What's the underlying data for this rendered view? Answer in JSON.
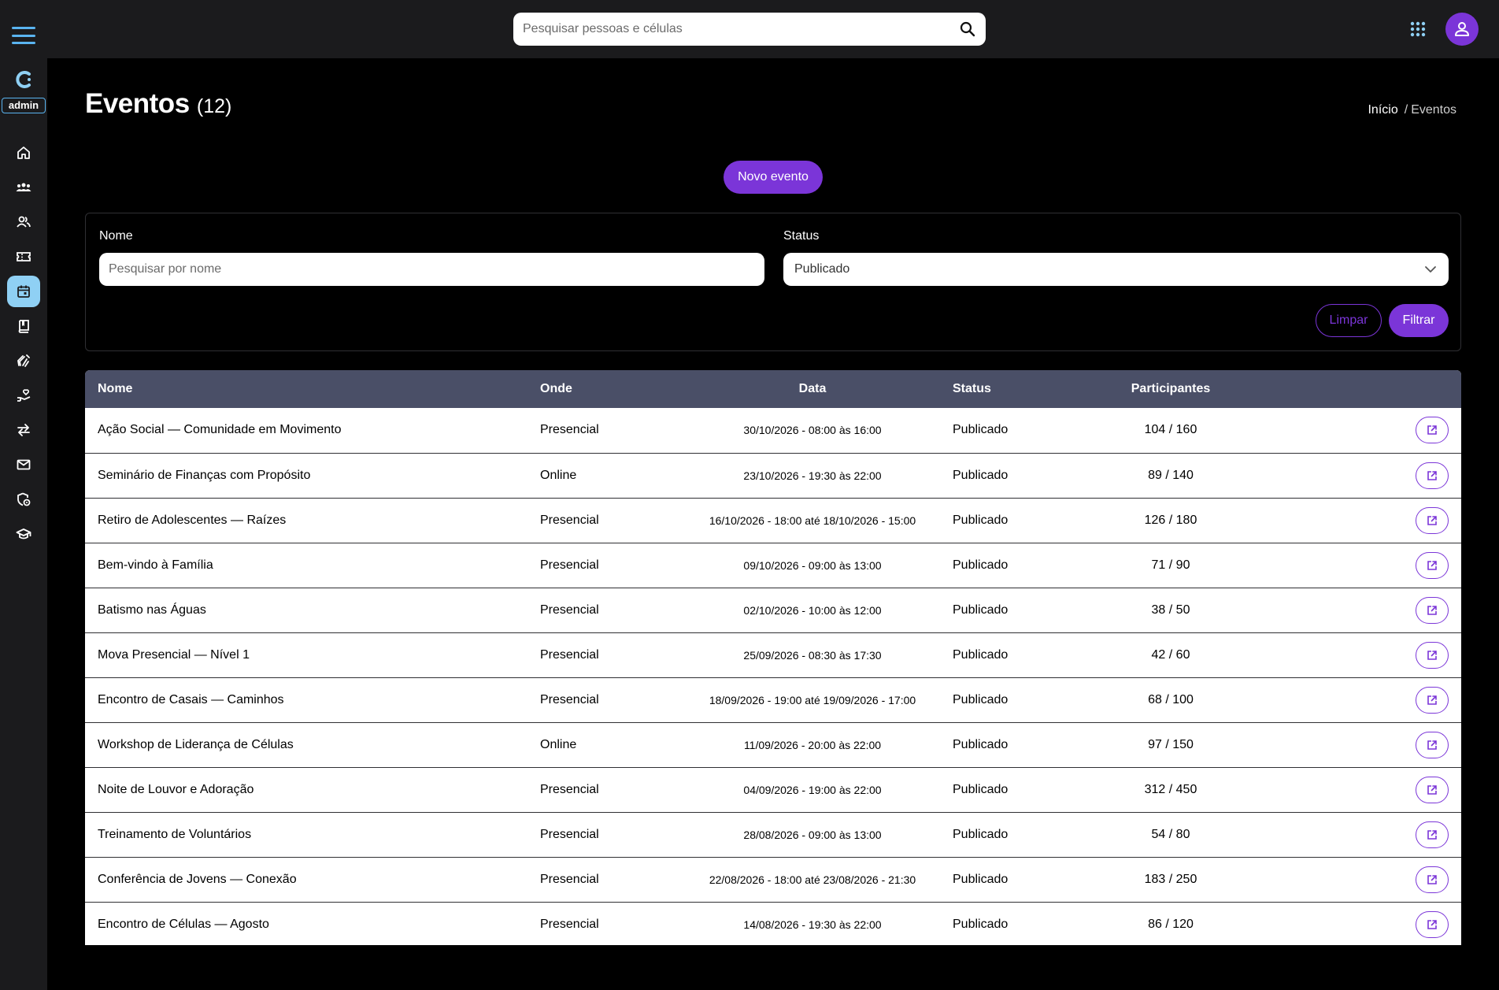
{
  "header": {
    "search_placeholder": "Pesquisar pessoas e células"
  },
  "sidebar": {
    "badge": "admin",
    "items": [
      {
        "icon": "home-icon"
      },
      {
        "icon": "group-icon"
      },
      {
        "icon": "people-icon"
      },
      {
        "icon": "ticket-icon"
      },
      {
        "icon": "calendar-icon",
        "active": true
      },
      {
        "icon": "book-icon"
      },
      {
        "icon": "hands-icon"
      },
      {
        "icon": "donation-icon"
      },
      {
        "icon": "transfer-icon"
      },
      {
        "icon": "mail-icon"
      },
      {
        "icon": "shield-settings-icon"
      },
      {
        "icon": "graduation-cap-icon"
      }
    ]
  },
  "page": {
    "title": "Eventos",
    "count": "(12)",
    "breadcrumb_home": "Início",
    "breadcrumb_sep": "/",
    "breadcrumb_current": "Eventos",
    "new_button": "Novo evento"
  },
  "filters": {
    "name_label": "Nome",
    "name_placeholder": "Pesquisar por nome",
    "status_label": "Status",
    "status_value": "Publicado",
    "clear_button": "Limpar",
    "filter_button": "Filtrar"
  },
  "table": {
    "columns": [
      "Nome",
      "Onde",
      "Data",
      "Status",
      "Participantes"
    ],
    "rows": [
      {
        "name": "Ação Social — Comunidade em Movimento",
        "where": "Presencial",
        "date": "30/10/2026 - 08:00 às 16:00",
        "status": "Publicado",
        "participants": "104 / 160"
      },
      {
        "name": "Seminário de Finanças com Propósito",
        "where": "Online",
        "date": "23/10/2026 - 19:30 às 22:00",
        "status": "Publicado",
        "participants": "89 / 140"
      },
      {
        "name": "Retiro de Adolescentes — Raízes",
        "where": "Presencial",
        "date": "16/10/2026 - 18:00 até 18/10/2026 - 15:00",
        "status": "Publicado",
        "participants": "126 / 180"
      },
      {
        "name": "Bem-vindo à Família",
        "where": "Presencial",
        "date": "09/10/2026 - 09:00 às 13:00",
        "status": "Publicado",
        "participants": "71 / 90"
      },
      {
        "name": "Batismo nas Águas",
        "where": "Presencial",
        "date": "02/10/2026 - 10:00 às 12:00",
        "status": "Publicado",
        "participants": "38 / 50"
      },
      {
        "name": "Mova Presencial — Nível 1",
        "where": "Presencial",
        "date": "25/09/2026 - 08:30 às 17:30",
        "status": "Publicado",
        "participants": "42 / 60"
      },
      {
        "name": "Encontro de Casais — Caminhos",
        "where": "Presencial",
        "date": "18/09/2026 - 19:00 até 19/09/2026 - 17:00",
        "status": "Publicado",
        "participants": "68 / 100"
      },
      {
        "name": "Workshop de Liderança de Células",
        "where": "Online",
        "date": "11/09/2026 - 20:00 às 22:00",
        "status": "Publicado",
        "participants": "97 / 150"
      },
      {
        "name": "Noite de Louvor e Adoração",
        "where": "Presencial",
        "date": "04/09/2026 - 19:00 às 22:00",
        "status": "Publicado",
        "participants": "312 / 450"
      },
      {
        "name": "Treinamento de Voluntários",
        "where": "Presencial",
        "date": "28/08/2026 - 09:00 às 13:00",
        "status": "Publicado",
        "participants": "54 / 80"
      },
      {
        "name": "Conferência de Jovens — Conexão",
        "where": "Presencial",
        "date": "22/08/2026 - 18:00 até 23/08/2026 - 21:30",
        "status": "Publicado",
        "participants": "183 / 250"
      },
      {
        "name": "Encontro de Células — Agosto",
        "where": "Presencial",
        "date": "14/08/2026 - 19:30 às 22:00",
        "status": "Publicado",
        "participants": "86 / 120"
      }
    ]
  },
  "colors": {
    "accent": "#7b35d8",
    "sidebar_active": "#8fd0f4",
    "table_header": "#4a4f67",
    "topbar": "#1b1b1d"
  }
}
